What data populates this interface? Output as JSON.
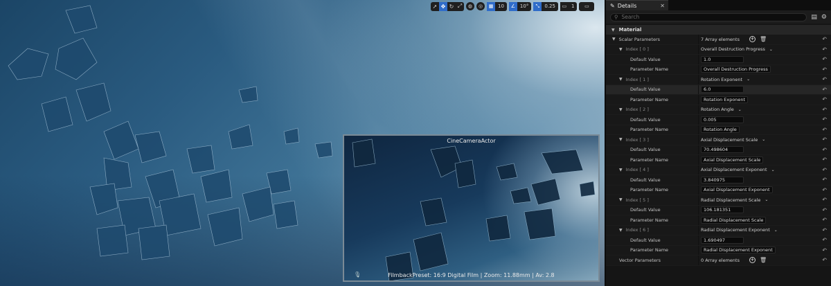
{
  "viewport": {
    "toolbar": {
      "grid_snap_value": "10",
      "rotation_snap_value": "10°",
      "scale_snap_value": "0.25",
      "camera_speed_value": "1"
    },
    "camera_preview": {
      "title": "CineCameraActor",
      "footer": "FilmbackPreset: 16:9 Digital Film | Zoom: 11.88mm | Av: 2.8"
    }
  },
  "details": {
    "tab_label": "Details",
    "search_placeholder": "Search",
    "section_label": "Material",
    "scalar_parameters": {
      "label": "Scalar Parameters",
      "count_text": "7 Array elements",
      "entries": [
        {
          "index": "Index [ 0 ]",
          "header_value": "Overall Destruction Progress",
          "default_label": "Default Value",
          "default_value": "1.0",
          "param_label": "Parameter Name",
          "param_name": "Overall Destruction Progress"
        },
        {
          "index": "Index [ 1 ]",
          "header_value": "Rotation Exponent",
          "default_label": "Default Value",
          "default_value": "6.0",
          "param_label": "Parameter Name",
          "param_name": "Rotation Exponent"
        },
        {
          "index": "Index [ 2 ]",
          "header_value": "Rotation Angle",
          "default_label": "Default Value",
          "default_value": "0.005",
          "param_label": "Parameter Name",
          "param_name": "Rotation Angle"
        },
        {
          "index": "Index [ 3 ]",
          "header_value": "Axial Displacement Scale",
          "default_label": "Default Value",
          "default_value": "70.498604",
          "param_label": "Parameter Name",
          "param_name": "Axial Displacement Scale"
        },
        {
          "index": "Index [ 4 ]",
          "header_value": "Axial Displacement Exponent",
          "default_label": "Default Value",
          "default_value": "3.840975",
          "param_label": "Parameter Name",
          "param_name": "Axial Displacement Exponent"
        },
        {
          "index": "Index [ 5 ]",
          "header_value": "Radial Displacement Scale",
          "default_label": "Default Value",
          "default_value": "106.181351",
          "param_label": "Parameter Name",
          "param_name": "Radial Displacement Scale"
        },
        {
          "index": "Index [ 6 ]",
          "header_value": "Radial Displacement Exponent",
          "default_label": "Default Value",
          "default_value": "1.690497",
          "param_label": "Parameter Name",
          "param_name": "Radial Displacement Exponent"
        }
      ]
    },
    "vector_parameters": {
      "label": "Vector Parameters",
      "count_text": "0 Array elements"
    }
  }
}
